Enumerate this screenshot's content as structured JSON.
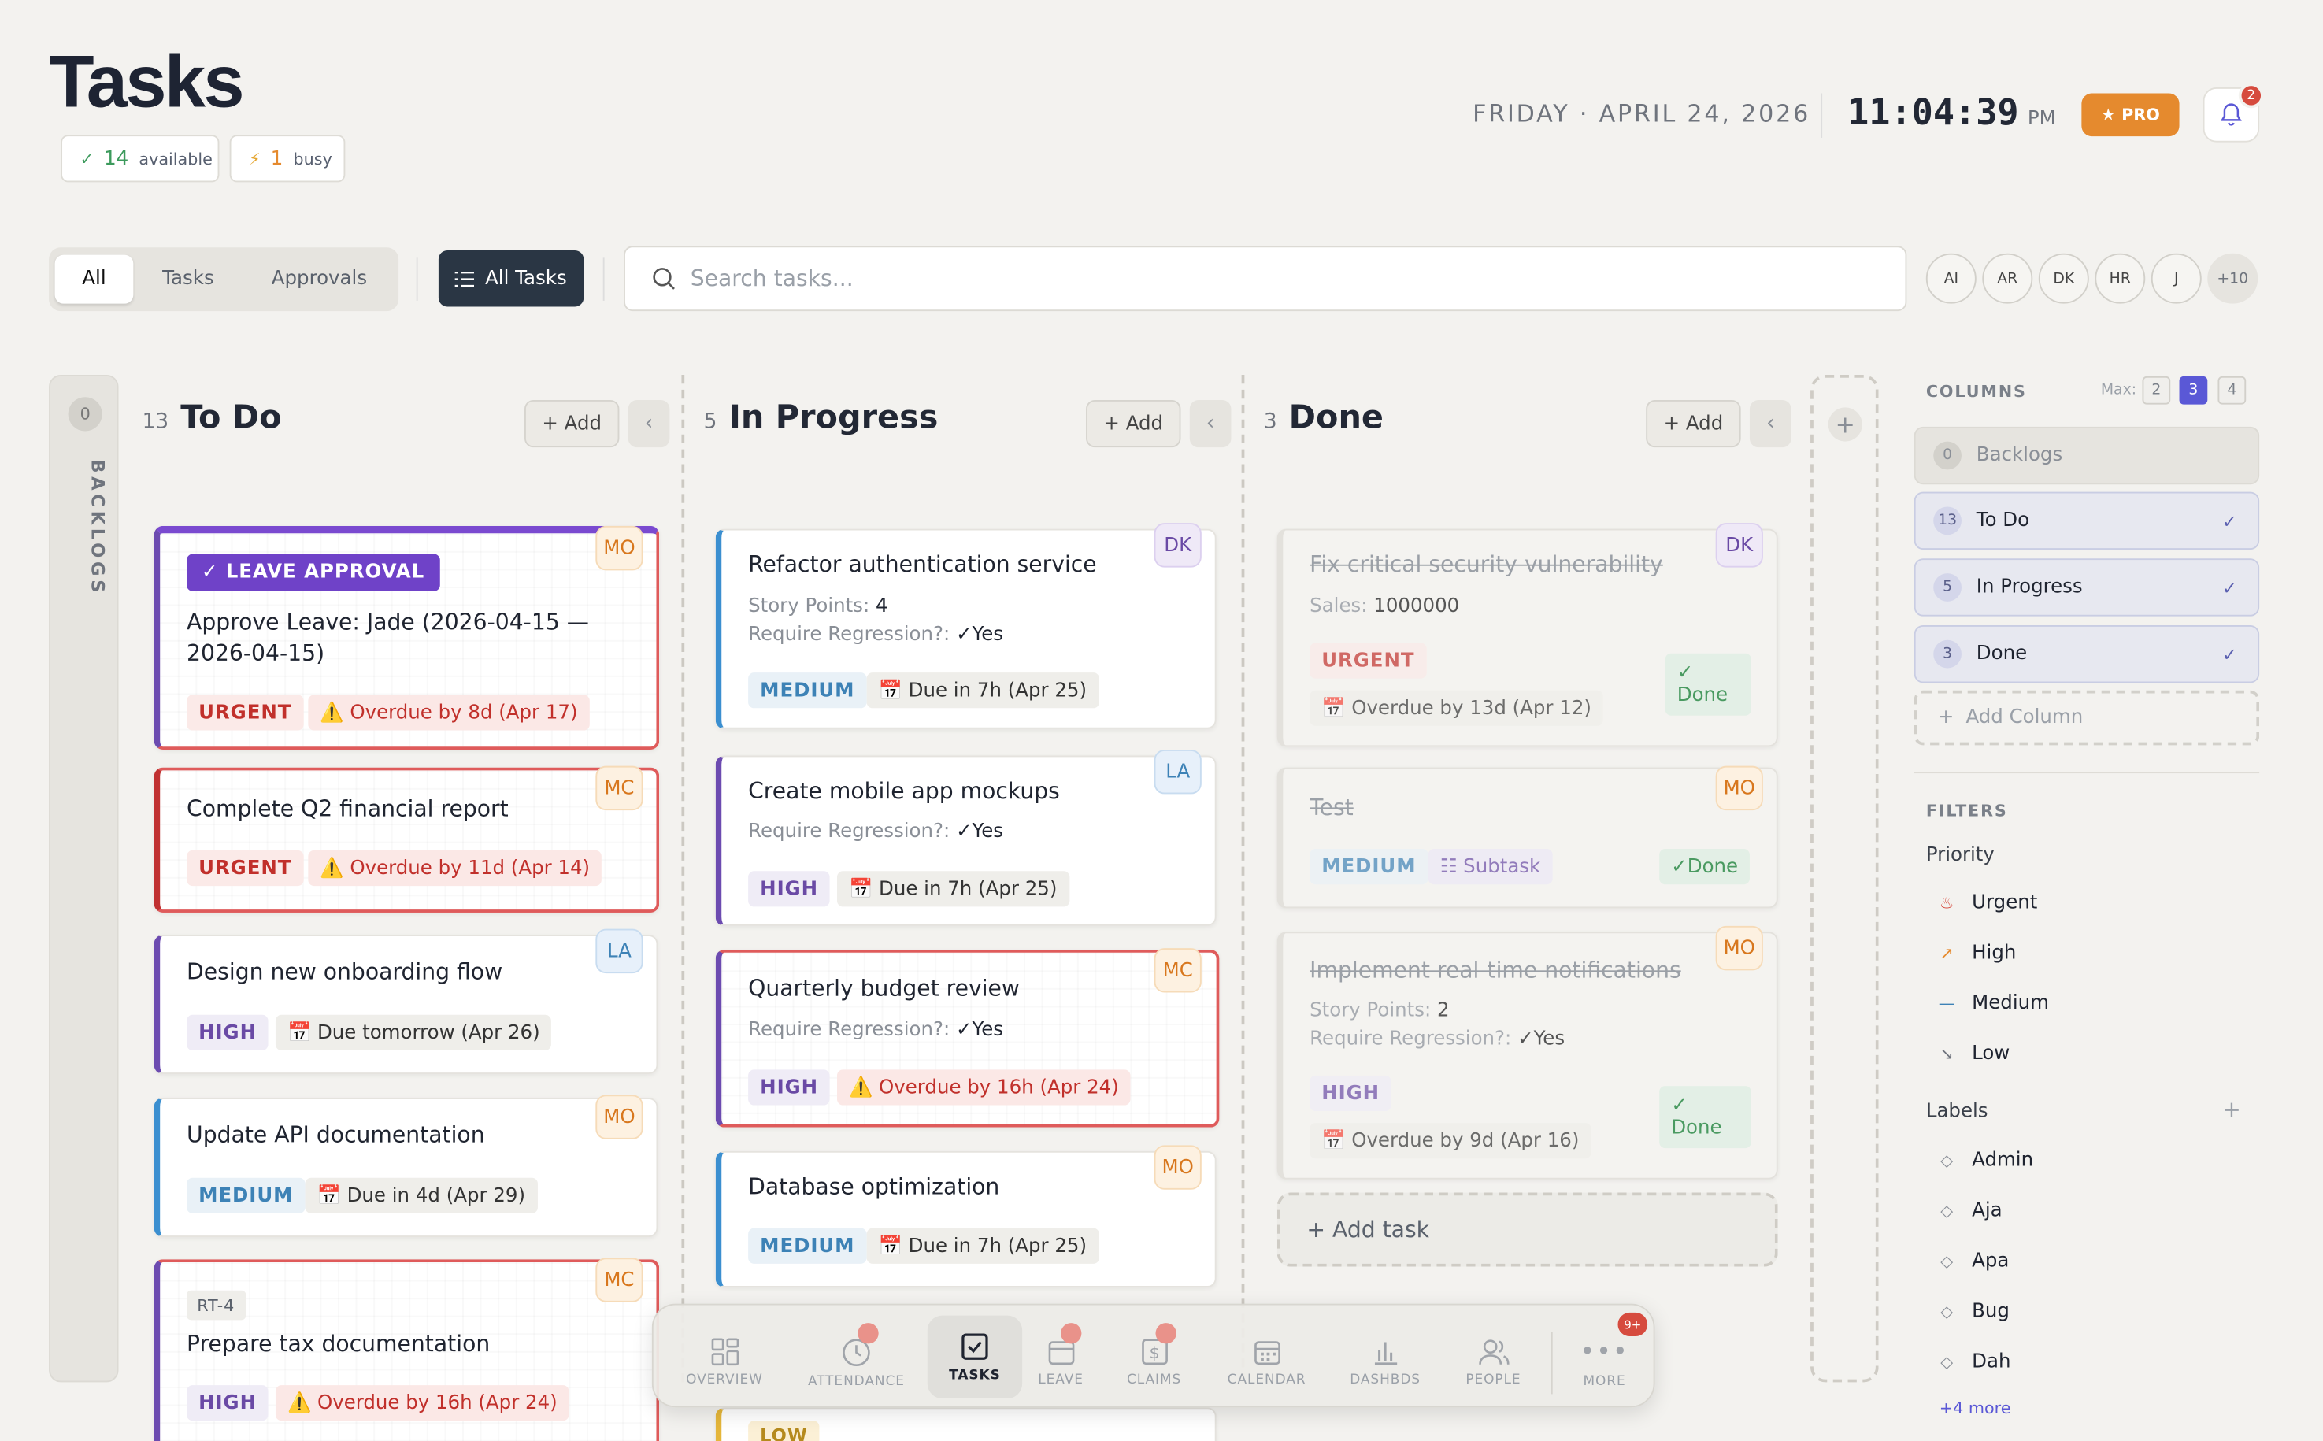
{
  "header": {
    "title": "Tasks",
    "available_count": "14",
    "available_label": "available",
    "busy_count": "1",
    "busy_label": "busy",
    "date": "FRIDAY · APRIL 24, 2026",
    "time": "11:04:39",
    "ampm": "PM",
    "pro_label": "PRO",
    "notif_count": "2"
  },
  "toolbar": {
    "segments": [
      "All",
      "Tasks",
      "Approvals"
    ],
    "active_segment": "All",
    "view_button": "All Tasks",
    "search_placeholder": "Search tasks...",
    "avatars": [
      "AI",
      "AR",
      "DK",
      "HR",
      "J",
      "+10"
    ]
  },
  "backlogs_rail": {
    "count": "0",
    "label": "BACKLOGS"
  },
  "columns": [
    {
      "count": "13",
      "title": "To Do",
      "add_label": "+ Add",
      "cards": [
        {
          "badge": "✓ LEAVE APPROVAL",
          "title": "Approve Leave: Jade (2026-04-15 — 2026-04-15)",
          "priority": "URGENT",
          "due": "Overdue by 8d (Apr 17)",
          "avatar": "MO"
        },
        {
          "title": "Complete Q2 financial report",
          "priority": "URGENT",
          "due": "Overdue by 11d (Apr 14)",
          "avatar": "MC"
        },
        {
          "title": "Design new onboarding flow",
          "priority": "HIGH",
          "due": "Due tomorrow (Apr 26)",
          "avatar": "LA"
        },
        {
          "title": "Update API documentation",
          "priority": "MEDIUM",
          "due": "Due in 4d (Apr 29)",
          "avatar": "MO"
        },
        {
          "ref": "RT-4",
          "title": "Prepare tax documentation",
          "priority": "HIGH",
          "due": "Overdue by 16h (Apr 24)",
          "avatar": "MC"
        }
      ]
    },
    {
      "count": "5",
      "title": "In Progress",
      "add_label": "+ Add",
      "cards": [
        {
          "title": "Refactor authentication service",
          "meta1_label": "Story Points:",
          "meta1_value": "4",
          "meta2_label": "Require Regression?:",
          "meta2_value": "✓Yes",
          "priority": "MEDIUM",
          "due": "Due in 7h (Apr 25)",
          "avatar": "DK"
        },
        {
          "title": "Create mobile app mockups",
          "meta1_label": "Require Regression?:",
          "meta1_value": "✓Yes",
          "priority": "HIGH",
          "due": "Due in 7h (Apr 25)",
          "avatar": "LA"
        },
        {
          "title": "Quarterly budget review",
          "meta1_label": "Require Regression?:",
          "meta1_value": "✓Yes",
          "priority": "HIGH",
          "due": "Overdue by 16h (Apr 24)",
          "avatar": "MC"
        },
        {
          "title": "Database optimization",
          "priority": "MEDIUM",
          "due": "Due in 7h (Apr 25)",
          "avatar": "MO"
        },
        {
          "priority": "LOW"
        }
      ]
    },
    {
      "count": "3",
      "title": "Done",
      "add_label": "+ Add",
      "cards": [
        {
          "title": "Fix critical security vulnerability",
          "meta1_label": "Sales:",
          "meta1_value": "1000000",
          "priority": "URGENT",
          "due": "Overdue by 13d (Apr 12)",
          "done_label": "Done",
          "avatar": "DK"
        },
        {
          "title": "Test",
          "priority": "MEDIUM",
          "subtask": "Subtask",
          "done_label": "Done",
          "avatar": "MO"
        },
        {
          "title": "Implement real-time notifications",
          "meta1_label": "Story Points:",
          "meta1_value": "2",
          "meta2_label": "Require Regression?:",
          "meta2_value": "✓Yes",
          "priority": "HIGH",
          "due": "Overdue by 9d (Apr 16)",
          "done_label": "Done",
          "avatar": "MO"
        }
      ],
      "add_task": "+ Add task"
    }
  ],
  "sidebar": {
    "columns_heading": "COLUMNS",
    "max_label": "Max:",
    "max_options": [
      "2",
      "3",
      "4"
    ],
    "max_selected": "3",
    "column_rows": [
      {
        "count": "0",
        "name": "Backlogs"
      },
      {
        "count": "13",
        "name": "To Do"
      },
      {
        "count": "5",
        "name": "In Progress"
      },
      {
        "count": "3",
        "name": "Done"
      }
    ],
    "add_column": "Add Column",
    "filters_heading": "FILTERS",
    "priority_heading": "Priority",
    "priorities": [
      "Urgent",
      "High",
      "Medium",
      "Low"
    ],
    "labels_heading": "Labels",
    "labels": [
      "Admin",
      "Aja",
      "Apa",
      "Bug",
      "Dah"
    ],
    "more_labels": "+4 more"
  },
  "dock": {
    "items": [
      "OVERVIEW",
      "ATTENDANCE",
      "TASKS",
      "LEAVE",
      "CLAIMS",
      "CALENDAR",
      "DASHBDS",
      "PEOPLE",
      "MORE"
    ],
    "active": "TASKS",
    "more_badge": "9+"
  },
  "colors": {
    "accent": "#5a58d6",
    "urgent": "#c1302b",
    "high": "#6a4aa5",
    "medium": "#3d82b6",
    "pro": "#e58a2e",
    "dark_button": "#2a3644"
  }
}
